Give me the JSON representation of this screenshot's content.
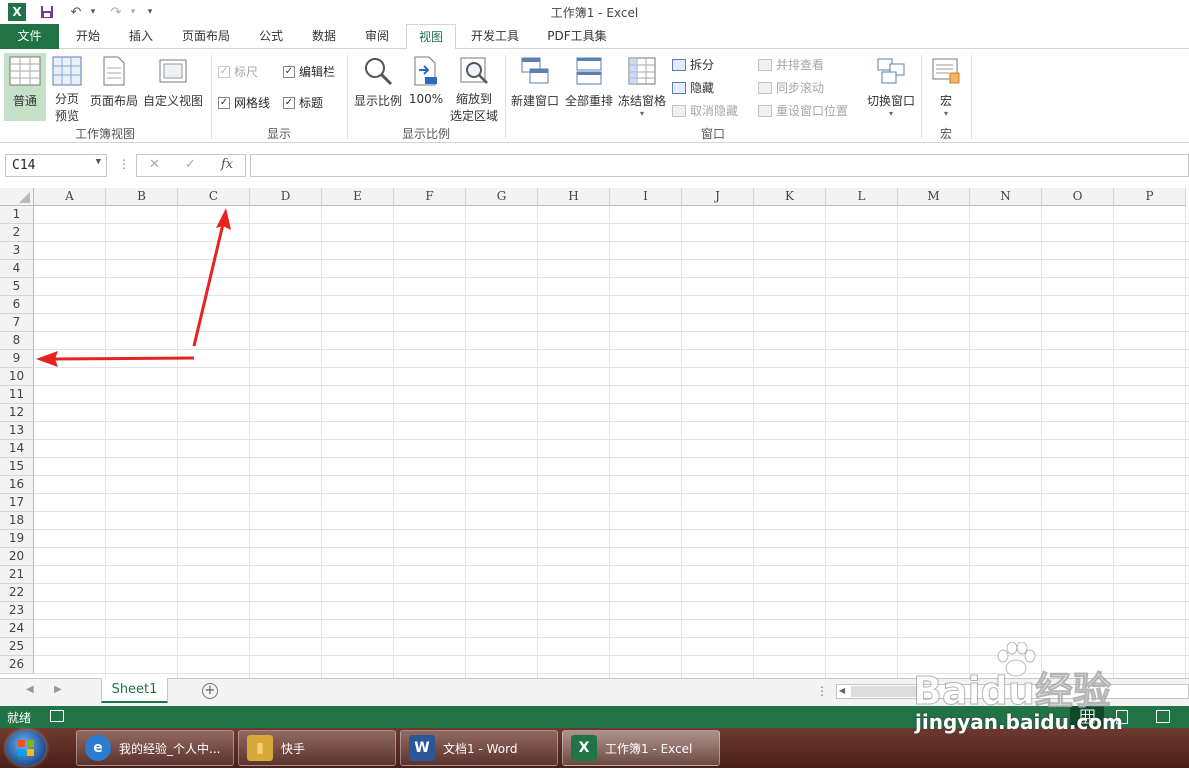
{
  "window": {
    "title": "工作簿1 - Excel"
  },
  "qat": {
    "undo": "↶",
    "redo": "↷",
    "more": "▾"
  },
  "tabs": [
    {
      "label": "文件"
    },
    {
      "label": "开始"
    },
    {
      "label": "插入"
    },
    {
      "label": "页面布局"
    },
    {
      "label": "公式"
    },
    {
      "label": "数据"
    },
    {
      "label": "审阅"
    },
    {
      "label": "视图"
    },
    {
      "label": "开发工具"
    },
    {
      "label": "PDF工具集"
    }
  ],
  "ribbon": {
    "workbook_views": {
      "normal": "普通",
      "page_break_1": "分页",
      "page_break_2": "预览",
      "page_layout": "页面布局",
      "custom_view": "自定义视图",
      "group": "工作簿视图"
    },
    "show": {
      "ruler": "标尺",
      "formula_bar": "编辑栏",
      "gridlines": "网格线",
      "headings": "标题",
      "group": "显示"
    },
    "zoom": {
      "zoom": "显示比例",
      "hundred": "100%",
      "zoom_sel_1": "缩放到",
      "zoom_sel_2": "选定区域",
      "group": "显示比例"
    },
    "window": {
      "new_window": "新建窗口",
      "arrange_all": "全部重排",
      "freeze": "冻结窗格",
      "split": "拆分",
      "hide": "隐藏",
      "unhide": "取消隐藏",
      "side_by_side": "并排查看",
      "sync_scroll": "同步滚动",
      "reset_pos": "重设窗口位置",
      "switch": "切换窗口",
      "group": "窗口"
    },
    "macros": {
      "macro": "宏",
      "group": "宏"
    }
  },
  "formula": {
    "name_box": "C14",
    "cancel": "✕",
    "enter": "✓",
    "fx": "fx"
  },
  "columns": [
    "A",
    "B",
    "C",
    "D",
    "E",
    "F",
    "G",
    "H",
    "I",
    "J",
    "K",
    "L",
    "M",
    "N",
    "O",
    "P"
  ],
  "rows": [
    "1",
    "2",
    "3",
    "4",
    "5",
    "6",
    "7",
    "8",
    "9",
    "10",
    "11",
    "12",
    "13",
    "14",
    "15",
    "16",
    "17",
    "18",
    "19",
    "20",
    "21",
    "22",
    "23",
    "24",
    "25",
    "26"
  ],
  "sheet": {
    "name": "Sheet1",
    "add": "+"
  },
  "status": {
    "ready": "就绪"
  },
  "taskbar": [
    {
      "label": "我的经验_个人中...",
      "color": "#2a7bd1",
      "glyph": "e"
    },
    {
      "label": "快手",
      "color": "#d9a93a",
      "glyph": "▮"
    },
    {
      "label": "文档1 - Word",
      "color": "#2b579a",
      "glyph": "W"
    },
    {
      "label": "工作簿1 - Excel",
      "color": "#217346",
      "glyph": "X"
    }
  ],
  "watermark": {
    "brand": "Baidu经验",
    "url": "jingyan.baidu.com"
  }
}
